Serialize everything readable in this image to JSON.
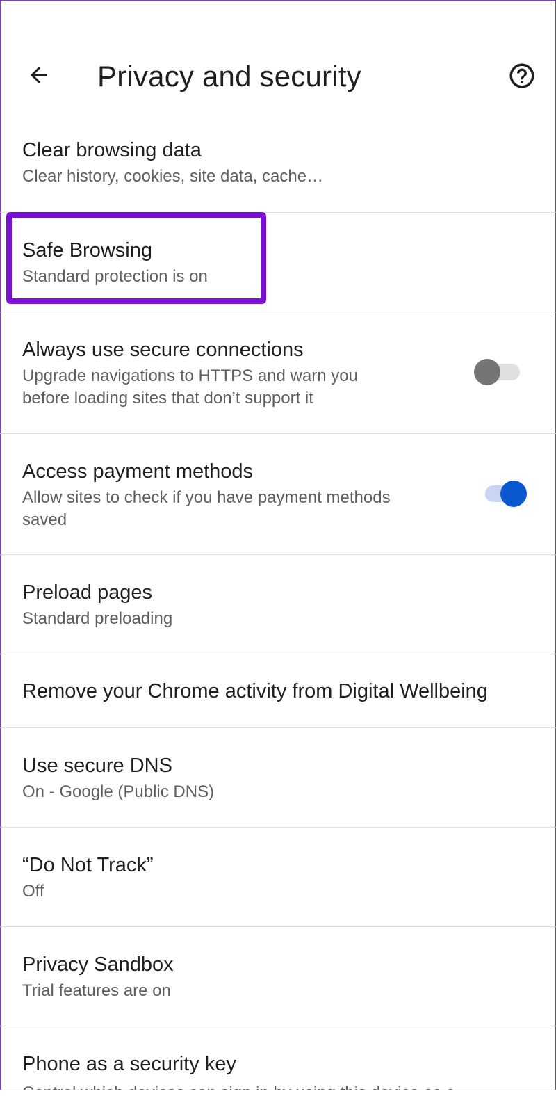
{
  "header": {
    "title": "Privacy and security",
    "back_icon": "arrow-back-icon",
    "help_icon": "help-circle-icon"
  },
  "items": [
    {
      "title": "Clear browsing data",
      "subtitle": "Clear history, cookies, site data, cache…"
    },
    {
      "title": "Safe Browsing",
      "subtitle": "Standard protection is on"
    },
    {
      "title": "Always use secure connections",
      "subtitle_line1": "Upgrade navigations to HTTPS and warn you",
      "subtitle_line2": "before loading sites that don’t support it",
      "toggle_on": false
    },
    {
      "title": "Access payment methods",
      "subtitle_line1": "Allow sites to check if you have payment methods",
      "subtitle_line2": "saved",
      "toggle_on": true
    },
    {
      "title": "Preload pages",
      "subtitle": "Standard preloading"
    },
    {
      "title": "Remove your Chrome activity from Digital Wellbeing"
    },
    {
      "title": "Use secure DNS",
      "subtitle": "On - Google (Public DNS)"
    },
    {
      "title": "“Do Not Track”",
      "subtitle": "Off"
    },
    {
      "title": "Privacy Sandbox",
      "subtitle": "Trial features are on"
    },
    {
      "title": "Phone as a security key",
      "subtitle": "Control which devices can sign in by using this device as a"
    }
  ],
  "colors": {
    "accent": "#0b57d0",
    "highlight": "#7a0fd6",
    "toggle_off_thumb": "#757575"
  }
}
